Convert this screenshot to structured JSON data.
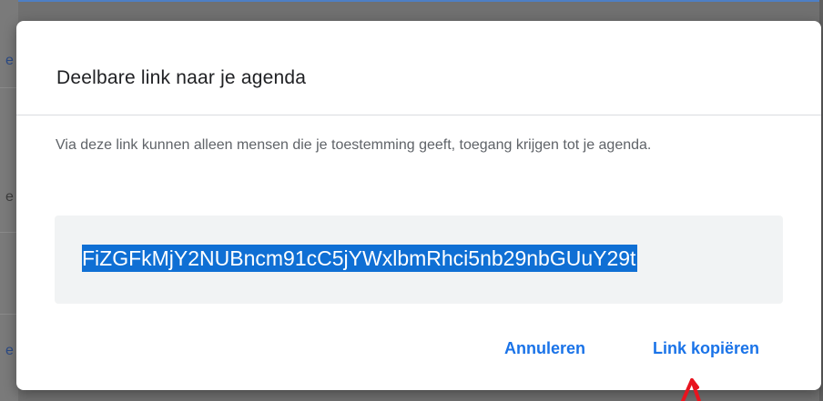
{
  "background": {
    "fragments": [
      "e",
      "e",
      "e"
    ]
  },
  "dialog": {
    "title": "Deelbare link naar je agenda",
    "description": "Via deze link kunnen alleen mensen die je toestemming geeft, toegang krijgen tot je agenda.",
    "link_value": "FiZGFkMjY2NUBncm91cC5jYWxlbmRhci5nb29nbGUuY29t",
    "buttons": {
      "cancel_label": "Annuleren",
      "copy_label": "Link kopiëren"
    }
  },
  "colors": {
    "accent": "#1a73e8",
    "selection": "#0f6fd4",
    "annotation": "#e8141f"
  },
  "icons": {
    "annotation": "red-arrow-annotation"
  }
}
